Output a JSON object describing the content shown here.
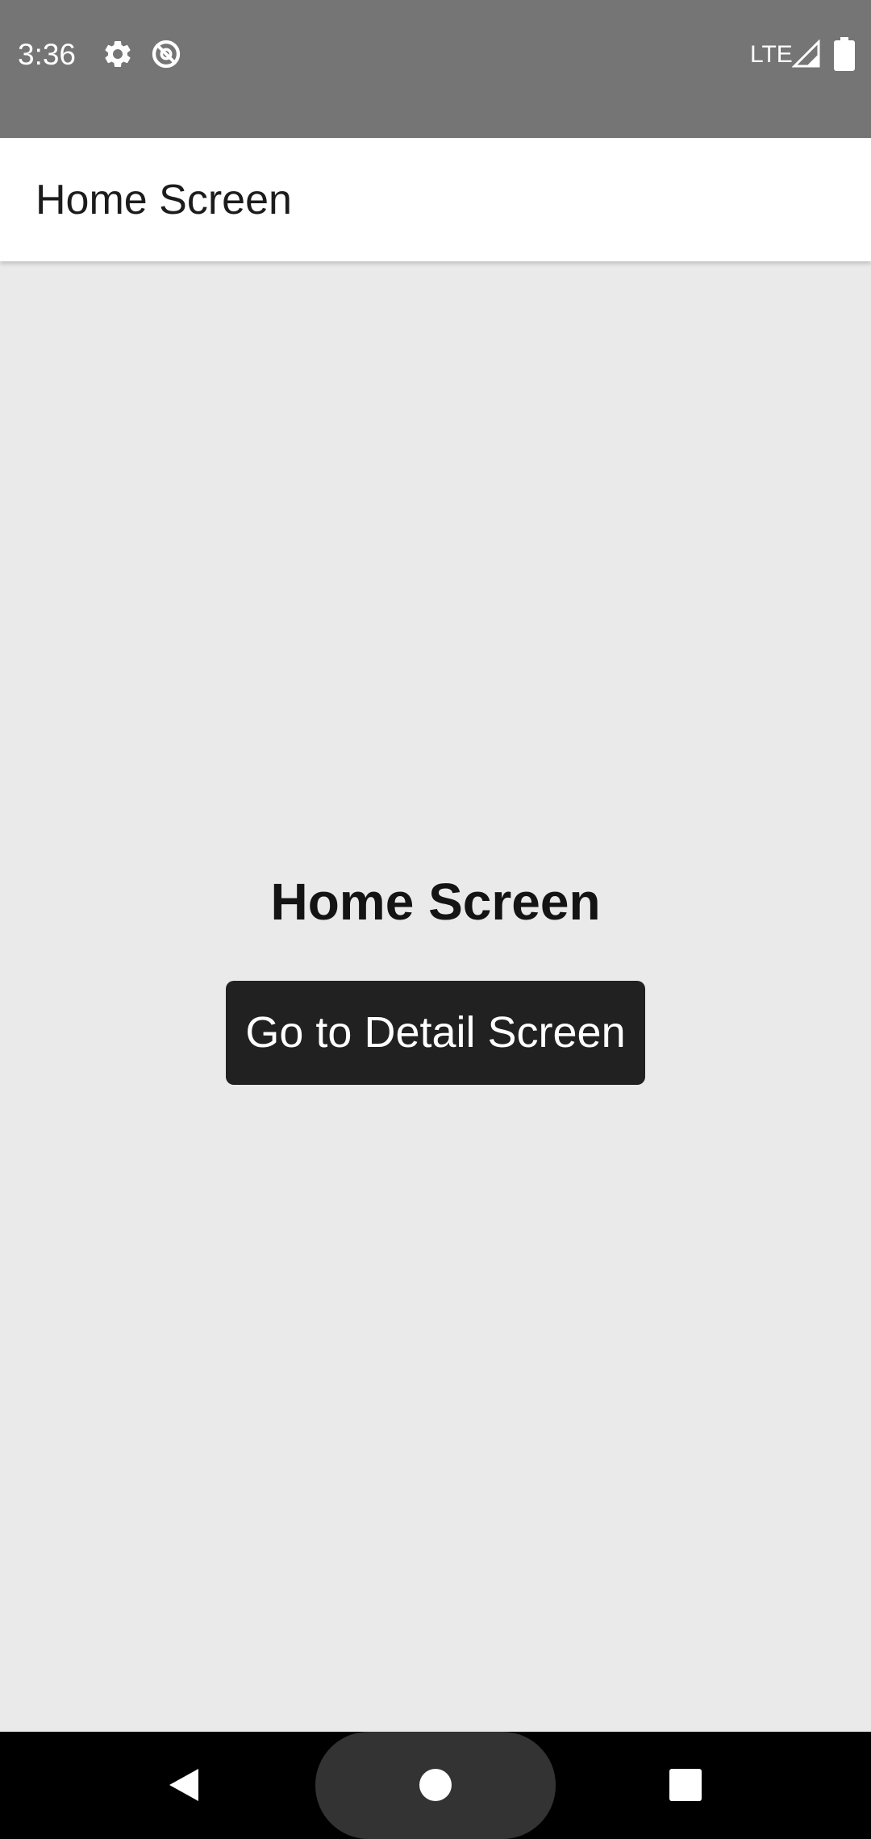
{
  "status_bar": {
    "time": "3:36",
    "network": "LTE",
    "icons": [
      "settings-gear-icon",
      "no-data-saver-icon",
      "signal-icon",
      "battery-icon"
    ]
  },
  "app_bar": {
    "title": "Home Screen"
  },
  "main": {
    "heading": "Home Screen",
    "button_label": "Go to Detail Screen"
  },
  "nav_bar": {
    "icons": [
      "back-icon",
      "home-icon",
      "recents-icon"
    ]
  },
  "colors": {
    "status_bar": "#757575",
    "app_bar": "#FFFFFF",
    "background": "#EAEAEA",
    "button": "#212121",
    "nav_bar": "#000000"
  }
}
